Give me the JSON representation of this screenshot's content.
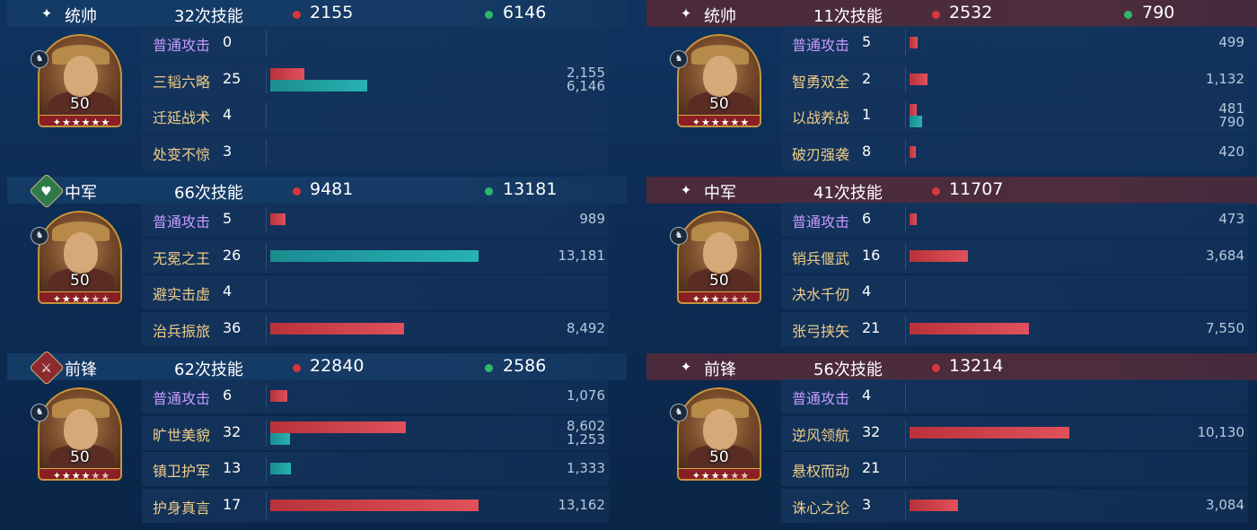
{
  "colors": {
    "damage": "#d8363c",
    "heal": "#2fb86a",
    "basic_attack": "#c79aff",
    "skill": "#f0cc86"
  },
  "left": {
    "groups": [
      {
        "role_icon": "sparkle-icon",
        "role": "统帅",
        "casts": "32次技能",
        "damage": "2155",
        "heal": "6146",
        "hero": {
          "level": "50",
          "stars": 5,
          "stars_filled": 5
        },
        "skills": [
          {
            "name": "普通攻击",
            "basic": true,
            "count": "0",
            "red": null,
            "teal": null
          },
          {
            "name": "三韬六略",
            "basic": false,
            "count": "25",
            "red": "2,155",
            "teal": "6,146",
            "red_frac": 0.164,
            "teal_frac": 0.466
          },
          {
            "name": "迁延战术",
            "basic": false,
            "count": "4",
            "red": null,
            "teal": null
          },
          {
            "name": "处变不惊",
            "basic": false,
            "count": "3",
            "red": null,
            "teal": null
          }
        ]
      },
      {
        "role_icon": "heart-badge-icon",
        "role": "中军",
        "casts": "66次技能",
        "damage": "9481",
        "heal": "13181",
        "hero": {
          "level": "50",
          "stars": 5,
          "stars_filled": 3
        },
        "skills": [
          {
            "name": "普通攻击",
            "basic": true,
            "count": "5",
            "red": "989",
            "teal": null,
            "red_frac": 0.075
          },
          {
            "name": "无冕之王",
            "basic": false,
            "count": "26",
            "red": null,
            "teal": "13,181",
            "teal_frac": 1.0
          },
          {
            "name": "避实击虚",
            "basic": false,
            "count": "4",
            "red": null,
            "teal": null
          },
          {
            "name": "治兵振旅",
            "basic": false,
            "count": "36",
            "red": "8,492",
            "teal": null,
            "red_frac": 0.644
          }
        ]
      },
      {
        "role_icon": "sword-badge-icon",
        "role": "前锋",
        "casts": "62次技能",
        "damage": "22840",
        "heal": "2586",
        "hero": {
          "level": "50",
          "stars": 5,
          "stars_filled": 3
        },
        "skills": [
          {
            "name": "普通攻击",
            "basic": true,
            "count": "6",
            "red": "1,076",
            "teal": null,
            "red_frac": 0.082
          },
          {
            "name": "旷世美貌",
            "basic": false,
            "count": "32",
            "red": "8,602",
            "teal": "1,253",
            "red_frac": 0.653,
            "teal_frac": 0.095
          },
          {
            "name": "镇卫护军",
            "basic": false,
            "count": "13",
            "red": null,
            "teal": "1,333",
            "teal_frac": 0.101
          },
          {
            "name": "护身真言",
            "basic": false,
            "count": "17",
            "red": "13,162",
            "teal": null,
            "red_frac": 0.999
          }
        ]
      }
    ]
  },
  "right": {
    "groups": [
      {
        "role_icon": "sparkle-icon",
        "role": "统帅",
        "casts": "11次技能",
        "damage": "2532",
        "heal": "790",
        "hero": {
          "level": "50",
          "stars": 5,
          "stars_filled": 5
        },
        "skills": [
          {
            "name": "普通攻击",
            "basic": true,
            "count": "5",
            "red": "499",
            "teal": null,
            "red_frac": 0.038
          },
          {
            "name": "智勇双全",
            "basic": false,
            "count": "2",
            "red": "1,132",
            "teal": null,
            "red_frac": 0.086
          },
          {
            "name": "以战养战",
            "basic": false,
            "count": "1",
            "red": "481",
            "teal": "790",
            "red_frac": 0.036,
            "teal_frac": 0.06
          },
          {
            "name": "破刃强袭",
            "basic": false,
            "count": "8",
            "red": "420",
            "teal": null,
            "red_frac": 0.032
          }
        ]
      },
      {
        "role_icon": "sparkle-icon",
        "role": "中军",
        "casts": "41次技能",
        "damage": "11707",
        "heal": null,
        "hero": {
          "level": "50",
          "stars": 5,
          "stars_filled": 2
        },
        "skills": [
          {
            "name": "普通攻击",
            "basic": true,
            "count": "6",
            "red": "473",
            "teal": null,
            "red_frac": 0.036
          },
          {
            "name": "销兵偃武",
            "basic": false,
            "count": "16",
            "red": "3,684",
            "teal": null,
            "red_frac": 0.28
          },
          {
            "name": "决水千仞",
            "basic": false,
            "count": "4",
            "red": null,
            "teal": null
          },
          {
            "name": "张弓挟矢",
            "basic": false,
            "count": "21",
            "red": "7,550",
            "teal": null,
            "red_frac": 0.573
          }
        ]
      },
      {
        "role_icon": "sparkle-icon",
        "role": "前锋",
        "casts": "56次技能",
        "damage": "13214",
        "heal": null,
        "hero": {
          "level": "50",
          "stars": 5,
          "stars_filled": 3
        },
        "skills": [
          {
            "name": "普通攻击",
            "basic": true,
            "count": "4",
            "red": null,
            "teal": null
          },
          {
            "name": "逆风领航",
            "basic": false,
            "count": "32",
            "red": "10,130",
            "teal": null,
            "red_frac": 0.769
          },
          {
            "name": "悬权而动",
            "basic": false,
            "count": "21",
            "red": null,
            "teal": null
          },
          {
            "name": "诛心之论",
            "basic": false,
            "count": "3",
            "red": "3,084",
            "teal": null,
            "red_frac": 0.234
          }
        ]
      }
    ]
  }
}
